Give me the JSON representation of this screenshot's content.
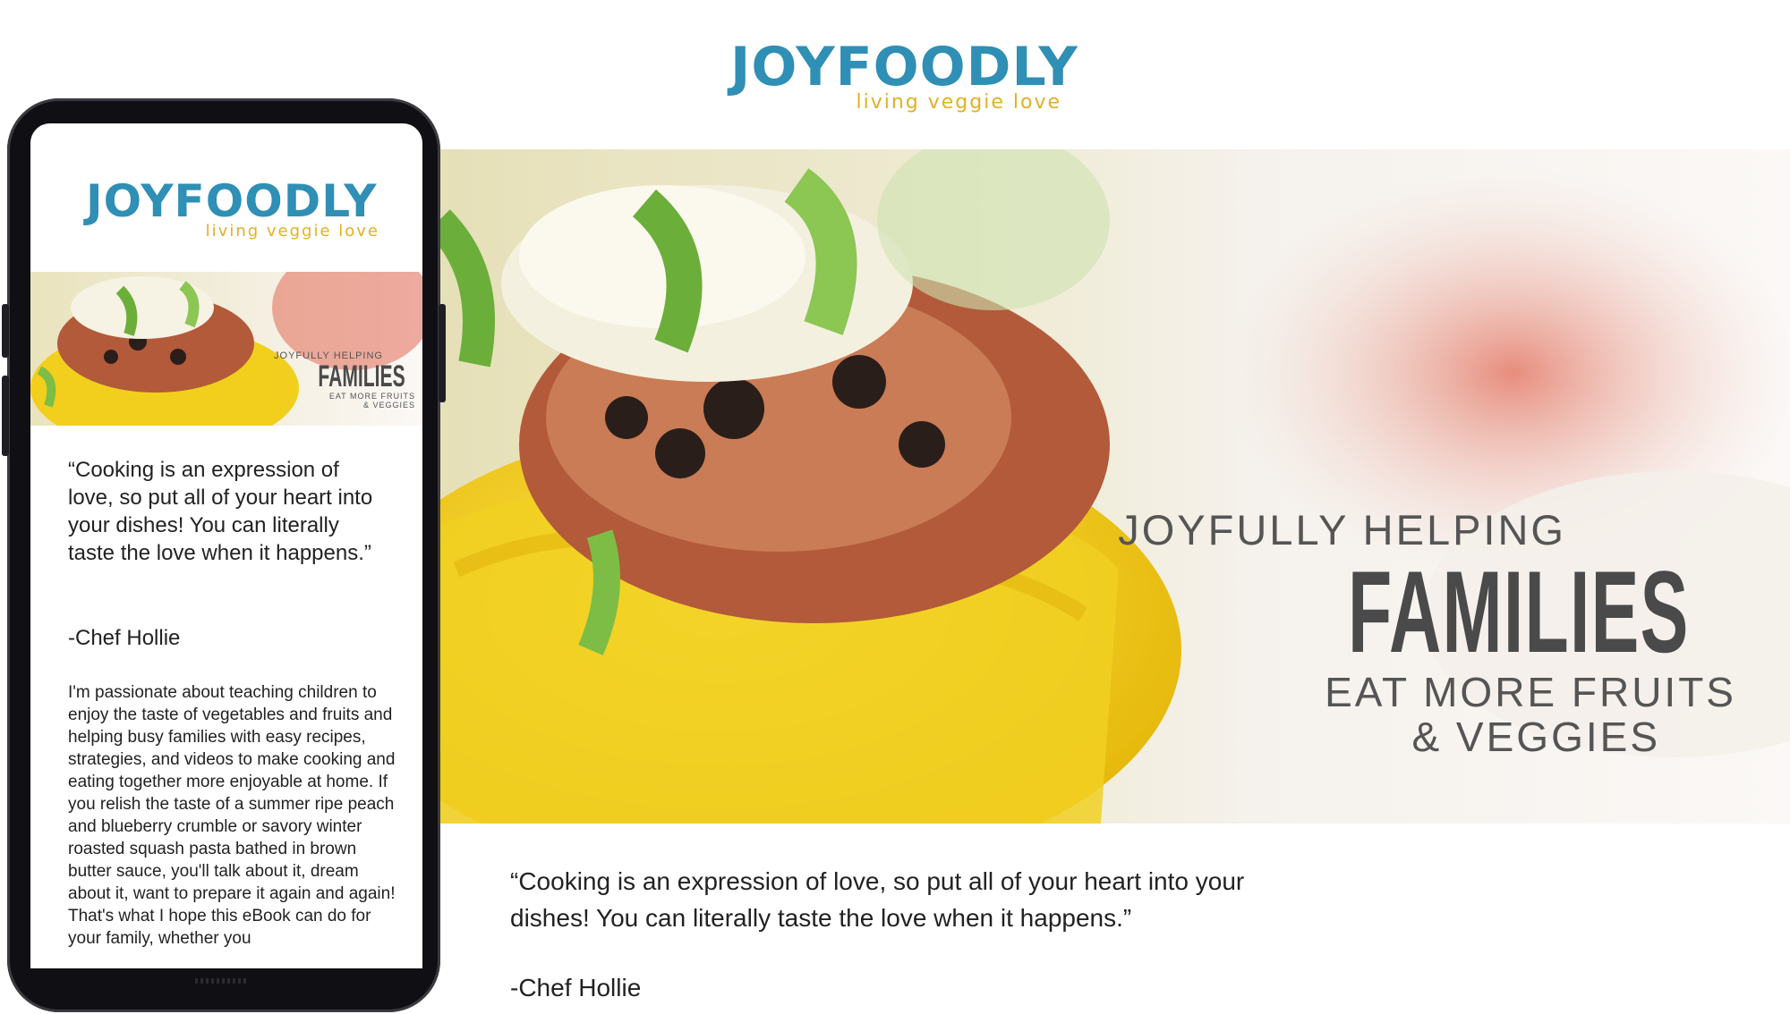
{
  "brand": {
    "name": "JOYFOODLY",
    "tagline": "living veggie love"
  },
  "hero": {
    "line1": "JOYFULLY HELPING",
    "line2": "FAMILIES",
    "line3": "EAT MORE FRUITS",
    "line4": "& VEGGIES"
  },
  "quote": "“Cooking is an expression of love, so put all of your heart into your dishes! You can literally taste the love when it happens.”",
  "author": "-Chef Hollie",
  "phone": {
    "hero_line1": "JOYFULLY HELPING",
    "hero_line2": "FAMILIES",
    "hero_line3": "EAT MORE FRUITS",
    "hero_line4": "& VEGGIES",
    "body": "I'm passionate about teaching children to enjoy the taste of vegetables and fruits and helping busy families with easy recipes, strategies, and videos to make cooking and eating together more enjoyable at home. If you relish the taste of a summer ripe peach and blueberry crumble or savory winter roasted squash pasta bathed in brown butter sauce, you'll talk about it, dream about it, want to prepare it again and again! That's what I hope this eBook can do for your family, whether you"
  },
  "colors": {
    "brand_blue": "#2f8fb5",
    "brand_yellow": "#e3b020",
    "squash_yellow": "#f3d21a"
  },
  "icons": {
    "hero_photo": "stuffed-squash-photo"
  }
}
